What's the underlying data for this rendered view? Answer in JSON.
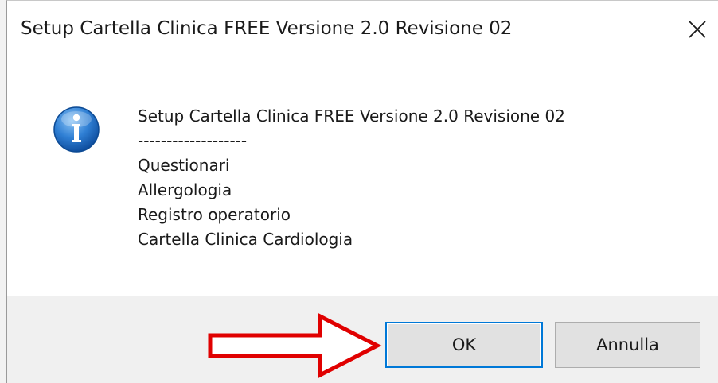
{
  "window": {
    "title": "Setup Cartella Clinica FREE Versione 2.0 Revisione 02",
    "close_icon": "close-icon"
  },
  "message": {
    "icon": "info-icon",
    "lines": [
      "Setup Cartella Clinica FREE Versione 2.0 Revisione 02",
      "-------------------",
      "Questionari",
      "Allergologia",
      "Registro operatorio",
      "Cartella Clinica Cardiologia"
    ]
  },
  "buttons": {
    "ok_label": "OK",
    "cancel_label": "Annulla"
  },
  "annotation": {
    "arrow_icon": "red-arrow-icon",
    "arrow_color": "#e00000"
  },
  "colors": {
    "focus_border": "#0078d7",
    "info_blue": "#1d6fc4"
  }
}
